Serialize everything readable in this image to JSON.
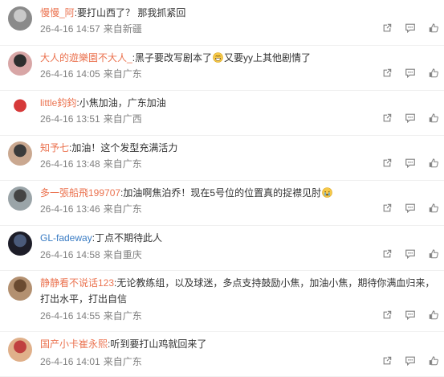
{
  "comments": [
    {
      "user": "慢慢_阿",
      "sep": ":",
      "text_before": "要打山西了？ 那我抓紧回",
      "text_after": "",
      "date": "26-4-16 14:57",
      "source": "来自新疆"
    },
    {
      "user": "大人的遊樂園不大人_",
      "sep": ":",
      "text_before": "黑子要改写剧本了",
      "text_after": "又要yy上其他剧情了",
      "date": "26-4-16 14:05",
      "source": "来自广东",
      "emoji": "grin-emoji"
    },
    {
      "user": "little鈞鈞",
      "sep": ":",
      "text_before": "小焦加油，广东加油",
      "text_after": "",
      "date": "26-4-16 13:51",
      "source": "来自广西"
    },
    {
      "user": "知予七",
      "sep": ":",
      "text_before": "加油！这个发型充满活力",
      "text_after": "",
      "date": "26-4-16 13:48",
      "source": "来自广东"
    },
    {
      "user": "多一張船飛199707",
      "sep": ":",
      "text_before": "加油啊焦泊乔！现在5号位的位置真的捉襟见肘",
      "text_after": "",
      "date": "26-4-16 13:46",
      "source": "来自广东",
      "emoji": "cry-emoji"
    },
    {
      "user": "GL-fadeway",
      "sep": ":",
      "text_before": "丁点不期待此人",
      "text_after": "",
      "date": "26-4-16 14:58",
      "source": "来自重庆"
    },
    {
      "user": "静静看不说话123",
      "sep": ":",
      "text_before": "无论教练组，以及球迷，多点支持鼓励小焦，加油小焦，期待你满血归来，打出水平，打出自信",
      "text_after": "",
      "date": "26-4-16 14:55",
      "source": "来自广东"
    },
    {
      "user": "国产小卡崔永熙",
      "sep": ":",
      "text_before": "听到要打山鸡就回来了",
      "text_after": "",
      "date": "26-4-16 14:01",
      "source": "来自广东"
    }
  ],
  "icons": [
    "share-icon",
    "comment-icon",
    "like-icon"
  ],
  "colors": {
    "username": "#eb7350",
    "username_alt": "#3a7cc4",
    "meta": "#808080",
    "icon": "#808080"
  }
}
